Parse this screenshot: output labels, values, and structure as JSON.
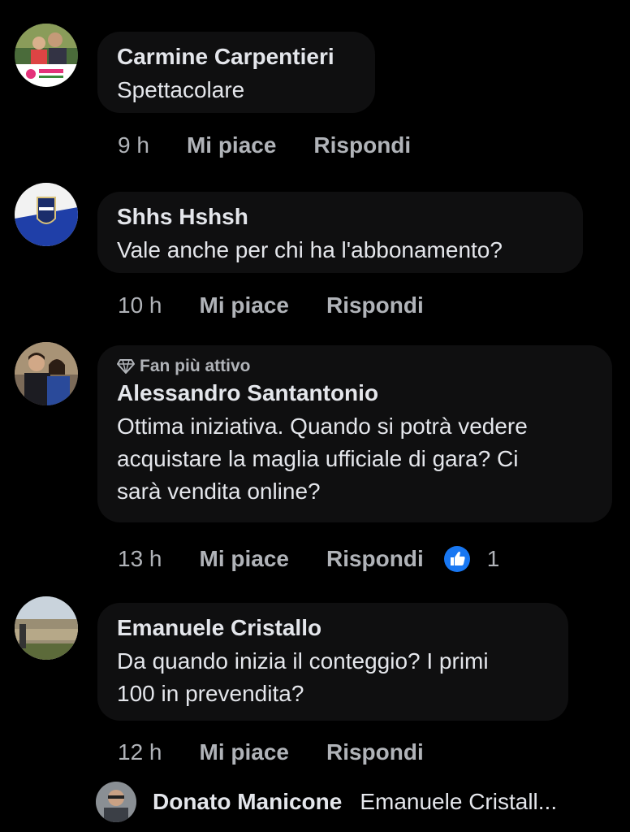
{
  "colors": {
    "background": "#000000",
    "bubble": "#0f0f10",
    "primary_text": "#e4e6eb",
    "secondary_text": "#b0b3b8",
    "like_blue": "#1877f2"
  },
  "comments": [
    {
      "author": "Carmine Carpentieri",
      "text": "Spettacolare",
      "time": "9 h",
      "like_label": "Mi piace",
      "reply_label": "Rispondi"
    },
    {
      "author": "Shhs Hshsh",
      "text": "Vale anche per chi ha l'abbonamento?",
      "time": "10 h",
      "like_label": "Mi piace",
      "reply_label": "Rispondi"
    },
    {
      "badge": "Fan più attivo",
      "badge_icon": "diamond-icon",
      "author": "Alessandro Santantonio",
      "text_lines": [
        "Ottima iniziativa. Quando si potrà vedere",
        "acquistare la maglia ufficiale di gara? Ci",
        "sarà vendita online?"
      ],
      "time": "13 h",
      "like_label": "Mi piace",
      "reply_label": "Rispondi",
      "reaction_icon": "like-icon",
      "reaction_count": "1"
    },
    {
      "author": "Emanuele Cristallo",
      "text_lines": [
        "Da quando inizia il conteggio? I primi",
        "100 in prevendita?"
      ],
      "time": "12 h",
      "like_label": "Mi piace",
      "reply_label": "Rispondi"
    }
  ],
  "reply_preview": {
    "author": "Donato Manicone",
    "text": "Emanuele Cristall..."
  }
}
